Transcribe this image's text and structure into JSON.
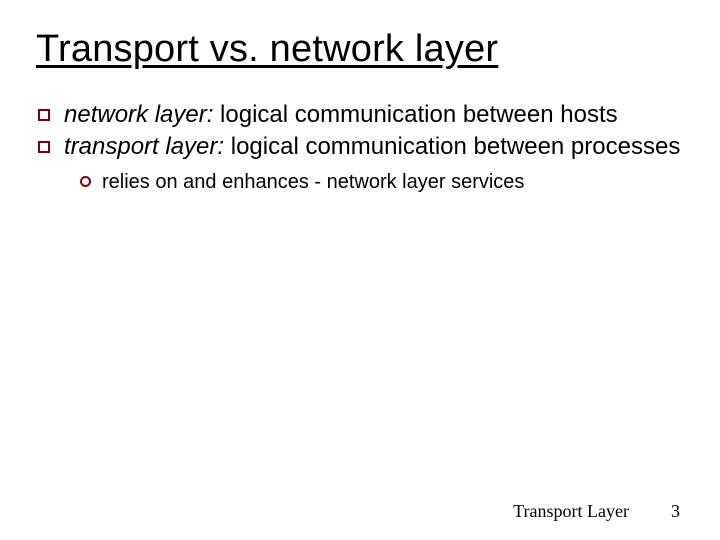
{
  "title": "Transport vs. network layer",
  "bullets": [
    {
      "prefix_italic": "network layer:",
      "rest": " logical communication between hosts"
    },
    {
      "prefix_italic": "transport layer:",
      "rest": " logical communication between processes"
    }
  ],
  "sub_bullets": [
    "relies on and enhances - network layer services"
  ],
  "footer": {
    "label": "Transport Layer",
    "page": "3"
  }
}
